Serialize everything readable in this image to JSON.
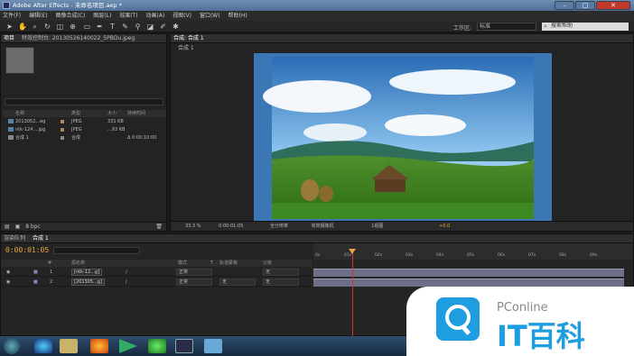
{
  "window": {
    "title": "Adobe After Effects - 未命名项目.aep *",
    "min": "–",
    "max": "□",
    "close": "✕"
  },
  "menu": [
    "文件(F)",
    "编辑(E)",
    "图像合成(C)",
    "图层(L)",
    "效果(T)",
    "动画(A)",
    "视图(V)",
    "窗口(W)",
    "帮助(H)"
  ],
  "toolbar": {
    "workspace_label": "工作区:",
    "workspace_value": "标准",
    "search_placeholder": "搜索帮助",
    "tools": [
      "selection-tool-icon",
      "hand-tool-icon",
      "zoom-tool-icon",
      "rotate-tool-icon",
      "camera-tool-icon",
      "pan-behind-icon",
      "mask-tool-icon",
      "pen-tool-icon",
      "text-tool-icon",
      "brush-tool-icon",
      "clone-stamp-icon",
      "eraser-icon",
      "roto-brush-icon",
      "puppet-tool-icon"
    ]
  },
  "project": {
    "tab_project": "项目",
    "tab_effects": "特效控制台: 20130526140022_5PBDu.jpeg",
    "columns": [
      "名称",
      "类型",
      "大小",
      "持续时间"
    ],
    "items": [
      {
        "name": "2013052...eg",
        "type": "JPEG",
        "size": "331 KB",
        "duration": ""
      },
      {
        "name": "ntk-124....jpg",
        "type": "JPEG",
        "size": "...93 KB",
        "duration": ""
      },
      {
        "name": "合成 1",
        "type": "合成",
        "size": "",
        "duration": "Δ 0:00:10:00"
      }
    ],
    "bpc": "8 bpc"
  },
  "viewer": {
    "tab": "合成: 合成 1",
    "subtab": "合成 1",
    "zoom": "33.3 %",
    "time": "0:00:01:05",
    "resolution": "全分辨率",
    "camera": "有效摄像机",
    "views": "1视图",
    "exposure": "+0.0"
  },
  "timeline": {
    "tab_render": "渲染队列",
    "tab_comp": "合成 1",
    "timecode": "0:00:01:05",
    "columns": [
      "#",
      "源名称",
      "模式",
      "T",
      "轨道蒙板",
      "父级"
    ],
    "layers": [
      {
        "num": "1",
        "name": "[ntk-12...g]",
        "mode": "正常",
        "trkmat": "",
        "parent": "无"
      },
      {
        "num": "2",
        "name": "[201305...g]",
        "mode": "正常",
        "trkmat": "无",
        "parent": "无"
      }
    ],
    "ruler_ticks": [
      "0s",
      "01s",
      "02s",
      "03s",
      "04s",
      "05s",
      "06s",
      "07s",
      "08s",
      "09s"
    ]
  },
  "watermark": {
    "brand": "PConline",
    "cn": "IT百科"
  }
}
